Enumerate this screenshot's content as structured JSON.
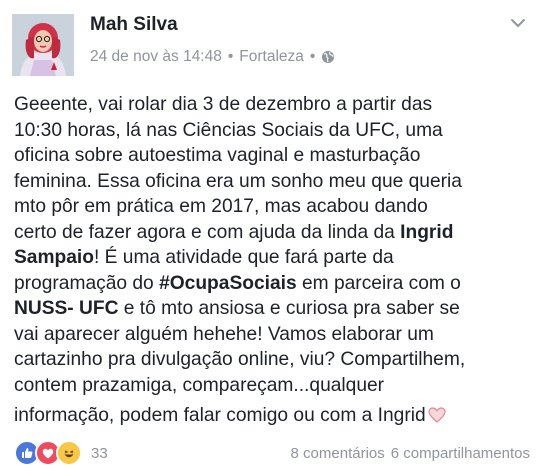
{
  "post": {
    "author": "Mah Silva",
    "date": "24 de nov às 14:48",
    "location": "Fortaleza",
    "separator": "•",
    "privacy_icon": "globe-icon",
    "menu_icon": "chevron-down-icon",
    "lines": [
      {
        "a": "Geeente, vai rolar dia 3 de dezembro a partir das",
        "b": "",
        "c": ""
      },
      {
        "a": "10:30 horas, lá nas Ciências Sociais da UFC, uma",
        "b": "",
        "c": ""
      },
      {
        "a": "oficina sobre autoestima vaginal e masturbação",
        "b": "",
        "c": ""
      },
      {
        "a": "feminina. Essa oficina era um sonho meu que queria",
        "b": "",
        "c": ""
      },
      {
        "a": "mto pôr em prática em 2017, mas acabou dando",
        "b": "",
        "c": ""
      },
      {
        "a": "certo de fazer agora e com ajuda da linda da ",
        "b": "Ingrid",
        "c": ""
      },
      {
        "a": "",
        "b": "Sampaio",
        "c": "! É uma atividade que fará parte da"
      },
      {
        "a": "programação do ",
        "b": "#OcupaSociais",
        "c": " em parceira com o"
      },
      {
        "a": "",
        "b": "NUSS- UFC",
        "c": " e tô mto ansiosa e curiosa pra saber se"
      },
      {
        "a": "vai aparecer alguém hehehe! Vamos elaborar um",
        "b": "",
        "c": ""
      },
      {
        "a": "cartazinho pra divulgação online, viu? Compartilhem,",
        "b": "",
        "c": ""
      },
      {
        "a": "contem prazamiga, compareçam...qualquer",
        "b": "",
        "c": ""
      },
      {
        "a": "informação, podem falar comigo ou com a Ingrid",
        "b": "",
        "c": ""
      }
    ],
    "end_emoji": "heart-icon"
  },
  "footer": {
    "reaction_icons": [
      "like-icon",
      "love-icon",
      "haha-icon"
    ],
    "reaction_count": "33",
    "comments": "8 comentários",
    "shares": "6 compartilhamentos"
  },
  "colors": {
    "text": "#1d2129",
    "meta": "#90949c",
    "like": "#4a77db",
    "love": "#ef4a5d",
    "haha": "#f7c745"
  }
}
